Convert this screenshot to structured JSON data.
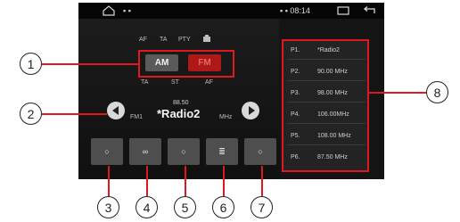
{
  "statusbar": {
    "home_icon": "home-icon",
    "left_icons": "▪ ▪",
    "right_text": "▪ ▪  08:14",
    "window_icon": "window-icon",
    "back_icon": "back-icon"
  },
  "top_labels": [
    "AF",
    "TA",
    "PTY"
  ],
  "top_icon": "settings-icon",
  "bands": {
    "am": "AM",
    "fm": "FM"
  },
  "sub_labels": [
    "TA",
    "ST",
    "AF"
  ],
  "tuner": {
    "band_label": "FM1",
    "frequency": "88.50",
    "station": "*Radio2",
    "unit": "MHz",
    "prev_icon": "prev-arrow-icon",
    "next_icon": "next-arrow-icon"
  },
  "function_buttons": [
    {
      "icon": "search-icon",
      "glyph": "○"
    },
    {
      "icon": "loop-icon",
      "glyph": "∞"
    },
    {
      "icon": "circle-icon",
      "glyph": "○"
    },
    {
      "icon": "save-icon",
      "glyph": "≣"
    },
    {
      "icon": "circle-icon",
      "glyph": "○"
    }
  ],
  "presets": [
    {
      "label": "P1.",
      "value": "*Radio2"
    },
    {
      "label": "P2.",
      "value": "90.00 MHz"
    },
    {
      "label": "P3.",
      "value": "98.00 MHz"
    },
    {
      "label": "P4.",
      "value": "106.00MHz"
    },
    {
      "label": "P5.",
      "value": "108.00 MHz"
    },
    {
      "label": "P6.",
      "value": "87.50 MHz"
    }
  ],
  "callouts": [
    "1",
    "2",
    "3",
    "4",
    "5",
    "6",
    "7",
    "8"
  ],
  "colors": {
    "highlight": "#e01820",
    "fm_active": "#b01818"
  }
}
